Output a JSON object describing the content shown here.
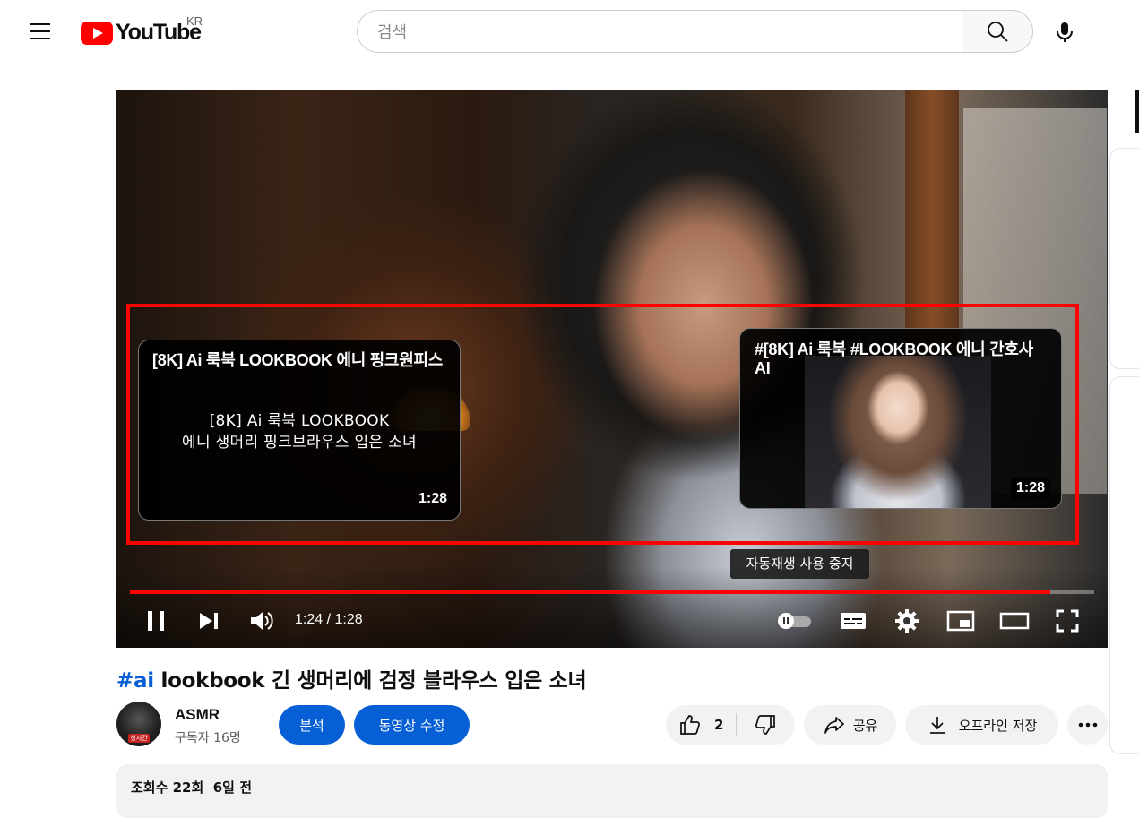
{
  "header": {
    "logo_text": "YouTube",
    "country": "KR",
    "search_placeholder": "검색"
  },
  "player": {
    "end_cards": [
      {
        "title": "[8K] Ai 룩북 LOOKBOOK 에니 핑크원피스",
        "thumbnail_text_line1": "[8K] Ai 룩북 LOOKBOOK",
        "thumbnail_text_line2": "에니 생머리 핑크브라우스 입은 소녀",
        "duration": "1:28"
      },
      {
        "title": "#[8K] Ai 룩북 #LOOKBOOK 에니 간호사 AI",
        "duration": "1:28"
      }
    ],
    "tooltip": "자동재생 사용 중지",
    "current_time": "1:24",
    "total_time": "1:28",
    "time_display": "1:24 / 1:28",
    "progress_fraction": 0.954,
    "colors": {
      "progress": "#ff0000",
      "highlight_box": "#ff0000"
    }
  },
  "video": {
    "title_hashtag": "#ai",
    "title_rest": " lookbook 긴 생머리에 검정 블라우스 입은 소녀",
    "channel_name": "ASMR",
    "subscribers": "구독자 16명",
    "avatar_badge": "성시간",
    "buttons": {
      "analytics": "분석",
      "edit_video": "동영상 수정",
      "like_count": "2",
      "share": "공유",
      "download": "오프라인 저장"
    },
    "meta": "조회수 22회  6일 전"
  },
  "icons": [
    "menu-icon",
    "youtube-logo-icon",
    "search-icon",
    "mic-icon",
    "pause-icon",
    "next-icon",
    "volume-icon",
    "autoplay-toggle-icon",
    "subtitles-icon",
    "settings-icon",
    "miniplayer-icon",
    "theater-icon",
    "fullscreen-icon",
    "like-icon",
    "dislike-icon",
    "share-icon",
    "download-icon",
    "more-icon"
  ]
}
